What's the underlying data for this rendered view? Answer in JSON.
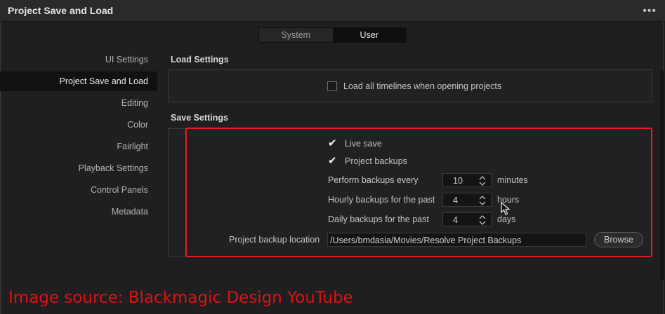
{
  "window": {
    "title": "Project Save and Load",
    "menu_icon": "more-dots-icon"
  },
  "tabs": [
    {
      "label": "System",
      "active": false
    },
    {
      "label": "User",
      "active": true
    }
  ],
  "sidebar": {
    "items": [
      {
        "label": "UI Settings"
      },
      {
        "label": "Project Save and Load",
        "selected": true
      },
      {
        "label": "Editing"
      },
      {
        "label": "Color"
      },
      {
        "label": "Fairlight"
      },
      {
        "label": "Playback Settings"
      },
      {
        "label": "Control Panels"
      },
      {
        "label": "Metadata"
      }
    ]
  },
  "load_settings": {
    "title": "Load Settings",
    "load_all_timelines": {
      "label": "Load all timelines when opening projects",
      "checked": false
    }
  },
  "save_settings": {
    "title": "Save Settings",
    "live_save": {
      "label": "Live save",
      "checked": true
    },
    "project_backups": {
      "label": "Project backups",
      "checked": true
    },
    "backup_every": {
      "label": "Perform backups every",
      "value": "10",
      "unit": "minutes"
    },
    "hourly": {
      "label": "Hourly backups for the past",
      "value": "4",
      "unit": "hours"
    },
    "daily": {
      "label": "Daily backups for the past",
      "value": "4",
      "unit": "days"
    },
    "location": {
      "label": "Project backup location",
      "value": "/Users/bmdasia/Movies/Resolve Project Backups",
      "browse_label": "Browse"
    }
  },
  "caption": "Image source: Blackmagic Design YouTube",
  "colors": {
    "highlight": "#e02020",
    "background": "#1f1f21"
  }
}
